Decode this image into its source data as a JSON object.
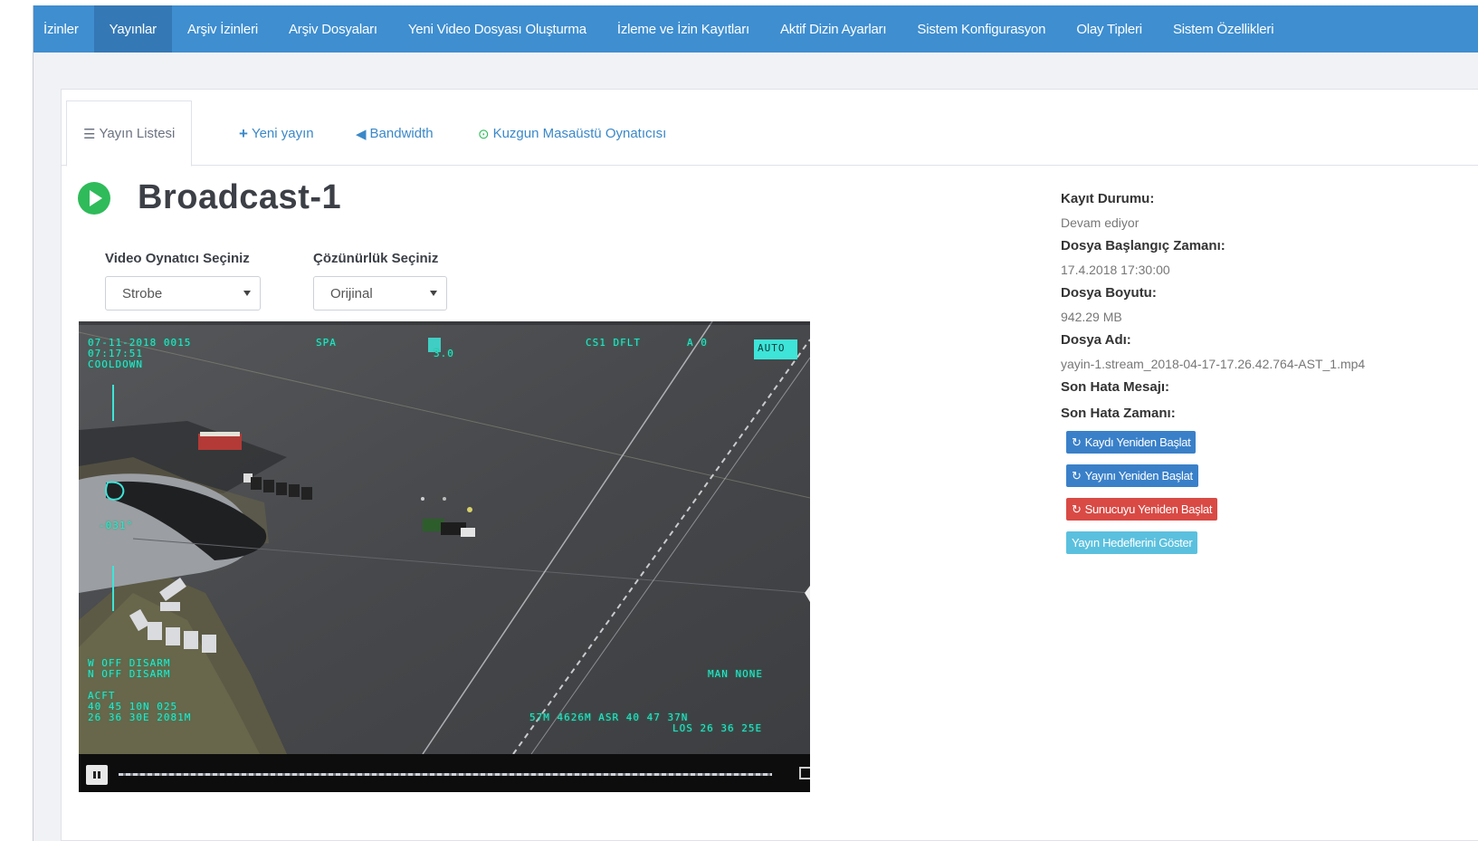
{
  "nav": {
    "items": [
      {
        "label": "İzinler"
      },
      {
        "label": "Yayınlar"
      },
      {
        "label": "Arşiv İzinleri"
      },
      {
        "label": "Arşiv Dosyaları"
      },
      {
        "label": "Yeni Video Dosyası Oluşturma"
      },
      {
        "label": "İzleme ve İzin Kayıtları"
      },
      {
        "label": "Aktif Dizin Ayarları"
      },
      {
        "label": "Sistem Konfigurasyon"
      },
      {
        "label": "Olay Tipleri"
      },
      {
        "label": "Sistem Özellikleri"
      }
    ],
    "active": "Yayınlar",
    "colors": {
      "bar": "#3e8ed0",
      "active": "#3478b5"
    }
  },
  "tabs": {
    "list_icon": "list-icon",
    "list_label": "Yayın Listesi",
    "new_icon": "plus-icon",
    "new_label": "Yeni yayın",
    "bandwidth_icon": "send-icon",
    "bandwidth_label": "Bandwidth",
    "player_icon": "play-circle-icon",
    "player_label": "Kuzgun Masaüstü Oynatıcısı"
  },
  "broadcast": {
    "status_icon": "play-circle-icon",
    "status_color": "#2fbb5a",
    "title": "Broadcast-1"
  },
  "player_select": {
    "label": "Video Oynatıcı Seçiniz",
    "value": "Strobe"
  },
  "resolution_select": {
    "label": "Çözünürlük Seçiniz",
    "value": "Orijinal"
  },
  "video": {
    "hud": {
      "tl1": "07-11-2018  0015",
      "tl2": "07:17:51",
      "tl3": "COOLDOWN",
      "top_mid1": "SPA",
      "top_mid2": "3.0",
      "top_right1": "CS1  DFLT",
      "top_right2": "A  0",
      "top_right3": "AUTO",
      "left_angle": "-031°",
      "bl1": "W   OFF   DISARM",
      "bl2": "N   OFF   DISARM",
      "bl3": "ACFT",
      "bl4": "40 45 10N  025",
      "bl5": "26 36 30E   2081M",
      "br1": "MAN   NONE",
      "br2": "57M   4626M   ASR   40 47 37N",
      "br3": "LOS   26 36 25E"
    }
  },
  "info": {
    "record_status_label": "Kayıt Durumu:",
    "record_status_value": "Devam ediyor",
    "file_start_label": "Dosya Başlangıç Zamanı:",
    "file_start_value": "17.4.2018 17:30:00",
    "file_size_label": "Dosya Boyutu:",
    "file_size_value": "942.29 MB",
    "file_name_label": "Dosya Adı:",
    "file_name_value": "yayin-1.stream_2018-04-17-17.26.42.764-AST_1.mp4",
    "last_error_label": "Son Hata Mesajı:",
    "last_error_time_label": "Son Hata Zamanı:"
  },
  "actions": {
    "restart_record": "Kaydı Yeniden Başlat",
    "restart_stream": "Yayını Yeniden Başlat",
    "restart_server": "Sunucuyu Yeniden Başlat",
    "show_targets": "Yayın Hedeflerini Göster",
    "refresh_icon": "refresh-icon",
    "colors": {
      "blue": "#3a80c9",
      "red": "#d94a45",
      "cyan": "#5bc0de"
    }
  }
}
